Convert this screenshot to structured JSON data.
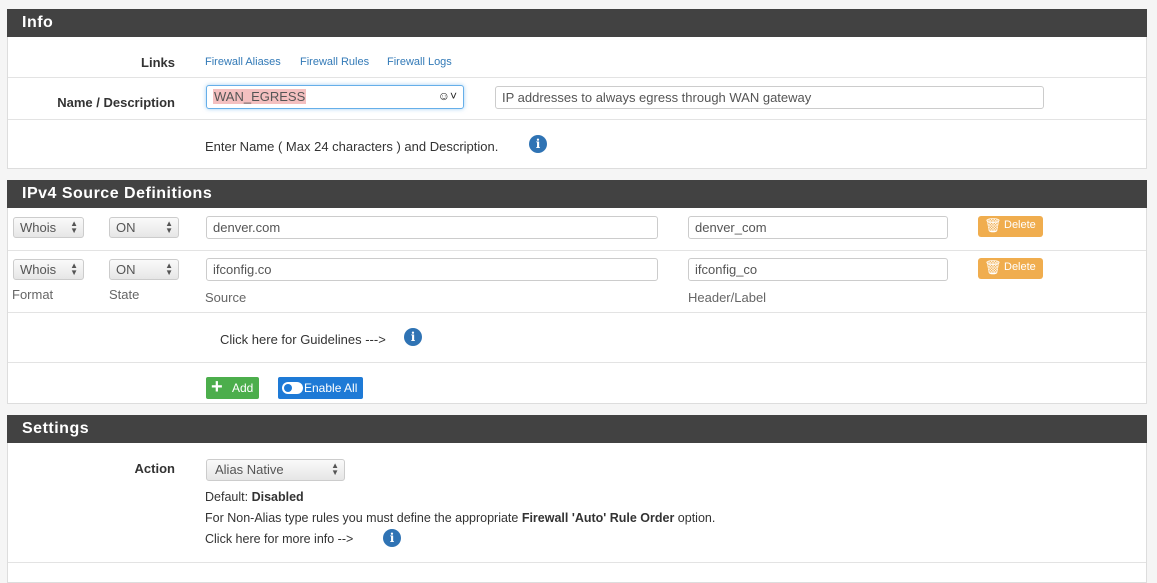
{
  "info": {
    "title": "Info",
    "links_label": "Links",
    "links": [
      "Firewall Aliases",
      "Firewall Rules",
      "Firewall Logs"
    ],
    "name_label": "Name / Description",
    "name_value": "WAN_EGRESS",
    "description_value": "IP addresses to always egress through WAN gateway",
    "help": "Enter Name ( Max 24 characters ) and Description."
  },
  "ipv4": {
    "title": "IPv4 Source Definitions",
    "rows": [
      {
        "format": "Whois",
        "state": "ON",
        "source": "denver.com",
        "label": "denver_com",
        "delete": "Delete"
      },
      {
        "format": "Whois",
        "state": "ON",
        "source": "ifconfig.co",
        "label": "ifconfig_co",
        "delete": "Delete"
      }
    ],
    "col_format": "Format",
    "col_state": "State",
    "col_source": "Source",
    "col_label": "Header/Label",
    "guidelines": "Click here for Guidelines --->",
    "add": "Add",
    "enable_all": "Enable All"
  },
  "settings": {
    "title": "Settings",
    "action_label": "Action",
    "action_value": "Alias Native",
    "default_prefix": "Default: ",
    "default_value": "Disabled",
    "note_prefix": "For Non-Alias type rules you must define the appropriate ",
    "note_bold": "Firewall 'Auto' Rule Order",
    "note_suffix": " option.",
    "more_info": "Click here for more info -->"
  },
  "colors": {
    "header": "#424242",
    "link": "#337ab7",
    "delete": "#f0ad4e",
    "add": "#4cae4c",
    "enable": "#1e7ad6",
    "info": "#2f73b4"
  }
}
